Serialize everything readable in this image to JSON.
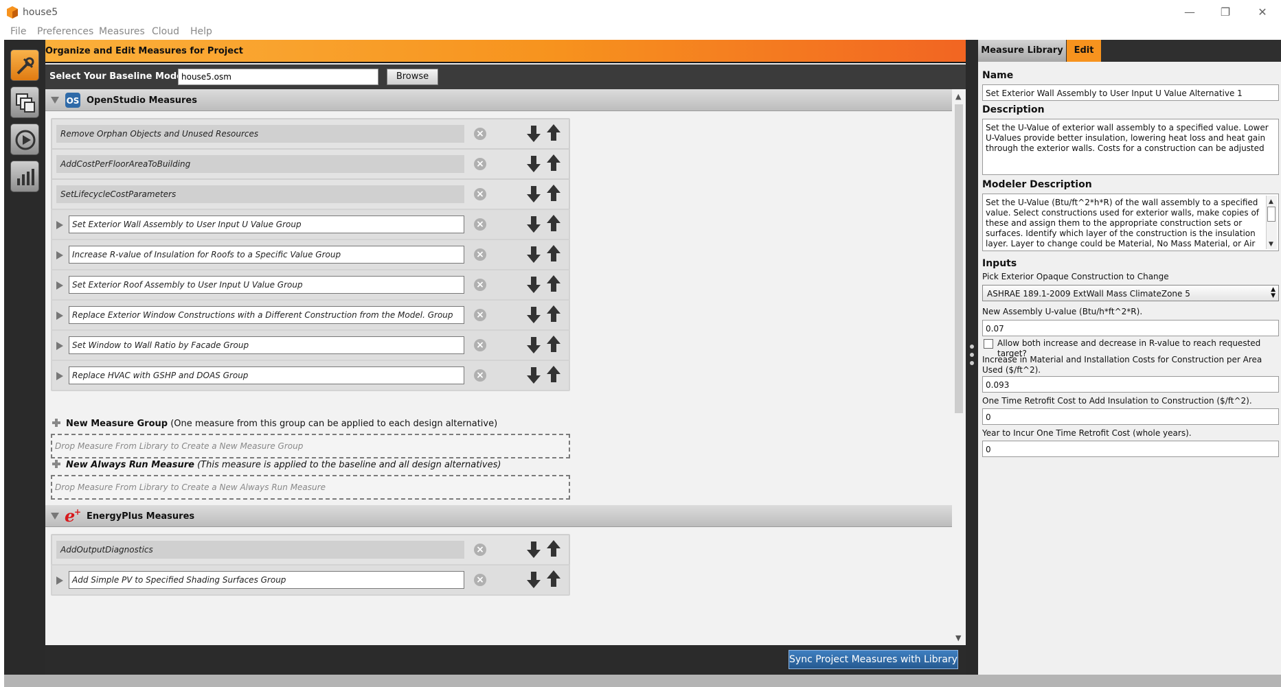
{
  "window": {
    "title": "house5"
  },
  "menu": [
    "File",
    "Preferences",
    "Measures",
    "Cloud",
    "Help"
  ],
  "main": {
    "header_title": "Organize and Edit Measures for Project",
    "baseline_label": "Select Your Baseline Model",
    "baseline_value": "house5.osm",
    "browse_label": "Browse",
    "openstudio_section": "OpenStudio Measures",
    "openstudio_measures": [
      {
        "name": "Remove Orphan Objects and Unused Resources",
        "group": false
      },
      {
        "name": "AddCostPerFloorAreaToBuilding",
        "group": false
      },
      {
        "name": "SetLifecycleCostParameters",
        "group": false
      },
      {
        "name": "Set Exterior Wall Assembly to User Input U Value Group",
        "group": true
      },
      {
        "name": "Increase R-value of Insulation for Roofs to a Specific Value Group",
        "group": true
      },
      {
        "name": "Set Exterior Roof Assembly to User Input U Value Group",
        "group": true
      },
      {
        "name": "Replace Exterior Window Constructions with a Different Construction from the Model. Group",
        "group": true
      },
      {
        "name": "Set Window to Wall Ratio by Facade Group",
        "group": true
      },
      {
        "name": "Replace HVAC with GSHP and DOAS Group",
        "group": true
      }
    ],
    "new_group_title": "New Measure Group",
    "new_group_desc": " (One measure from this group can be applied to each design alternative)",
    "new_group_drop": "Drop Measure From Library to Create a New Measure Group",
    "new_always_title": "New Always Run Measure",
    "new_always_desc": " (This measure is applied to the baseline and all design alternatives)",
    "new_always_drop": "Drop Measure From Library to Create a New Always Run Measure",
    "energyplus_section": "EnergyPlus Measures",
    "energyplus_measures": [
      {
        "name": "AddOutputDiagnostics",
        "group": false
      },
      {
        "name": "Add Simple PV to Specified Shading Surfaces Group",
        "group": true
      }
    ],
    "sync_label": "Sync Project Measures with Library"
  },
  "right": {
    "tab_library": "Measure Library",
    "tab_edit": "Edit",
    "name_heading": "Name",
    "name_value": "Set Exterior Wall Assembly to User Input U Value Alternative 1",
    "description_heading": "Description",
    "description_value": "Set the U-Value of exterior wall assembly to a specified value.  Lower U-Values provide better insulation, lowering heat loss and heat gain through the exterior walls. Costs for a construction can be adjusted",
    "modeler_heading": "Modeler Description",
    "modeler_value": "Set the U-Value (Btu/ft^2*h*R) of the wall assembly to a specified value. Select constructions used for exterior walls, make copies of these and assign them to the appropriate construction sets or surfaces. Identify which layer of the construction is the insulation layer. Layer to change could be Material, No Mass Material, or Air Gap",
    "inputs_heading": "Inputs",
    "pick_label": "Pick Exterior Opaque Construction to Change",
    "pick_value": "ASHRAE 189.1-2009 ExtWall Mass ClimateZone 5",
    "uvalue_label": "New Assembly U-value (Btu/h*ft^2*R).",
    "uvalue_value": "0.07",
    "allow_label": "Allow both increase and decrease in R-value to reach requested target?",
    "cost_label": "Increase in Material and Installation Costs for Construction per Area Used ($/ft^2).",
    "cost_value": "0.093",
    "retrofit_label": "One Time Retrofit Cost to Add Insulation to Construction ($/ft^2).",
    "retrofit_value": "0",
    "year_label": "Year to Incur One Time Retrofit Cost (whole years).",
    "year_value": "0"
  },
  "colors": {
    "accent": "#f7931e",
    "sync_button": "#2f6aa8"
  }
}
